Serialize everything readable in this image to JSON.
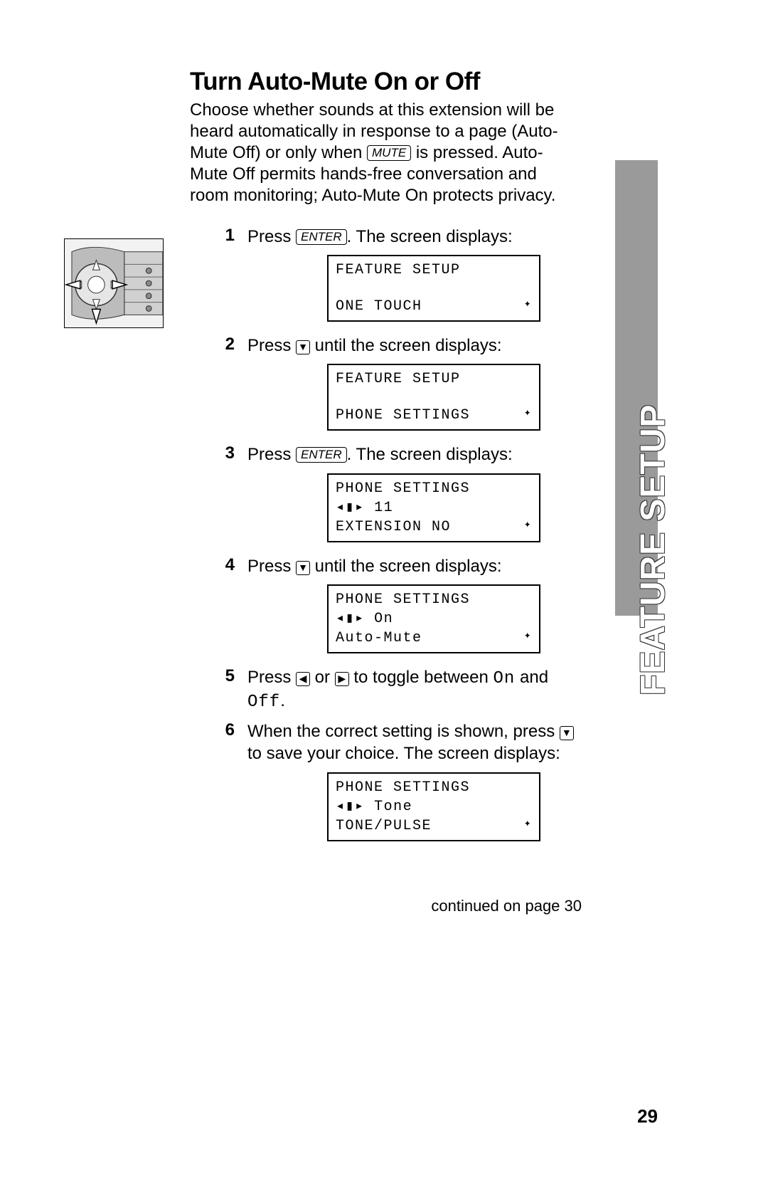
{
  "title": "Turn Auto-Mute On or Off",
  "intro": {
    "p1a": "Choose whether sounds at this extension will be heard automatically in response to a page (Auto-Mute Off) or only when ",
    "mute_key": "MUTE",
    "p1b": " is pressed.  Auto-Mute Off permits hands-free conversation and room monitoring; Auto-Mute On protects privacy."
  },
  "side_tab": "FEATURE SETUP",
  "keys": {
    "enter": "ENTER",
    "down": "▼",
    "left": "◀",
    "right": "▶"
  },
  "steps": [
    {
      "n": "1",
      "pre": "Press ",
      "key": "enter",
      "post": ".  The screen displays:",
      "lcd": {
        "l1": "FEATURE SETUP",
        "l2": "",
        "l3": "ONE TOUCH",
        "nav": "⯁"
      }
    },
    {
      "n": "2",
      "pre": "Press ",
      "key": "down",
      "post": " until the screen displays:",
      "lcd": {
        "l1": "FEATURE SETUP",
        "l2": "",
        "l3": "PHONE SETTINGS",
        "nav": "⯁"
      }
    },
    {
      "n": "3",
      "pre": "Press ",
      "key": "enter",
      "post": ".  The screen displays:",
      "lcd": {
        "l1": "PHONE SETTINGS",
        "l2": "�興 11",
        "l3": "EXTENSION NO",
        "nav": "⯁"
      }
    },
    {
      "n": "4",
      "pre": "Press ",
      "key": "down",
      "post": " until the screen displays:",
      "lcd": {
        "l1": "PHONE SETTINGS",
        "l2": "⯁ On",
        "l3": "Auto-Mute",
        "nav": "⯁"
      }
    },
    {
      "n": "5",
      "text_a": "Press ",
      "text_b": " or ",
      "text_c": " to toggle between ",
      "val1": "On",
      "text_d": " and ",
      "val2": "Off",
      "text_e": "."
    },
    {
      "n": "6",
      "text_a": "When the correct setting is shown, press ",
      "text_b": " to save your choice.  The screen displays:",
      "lcd": {
        "l1": "PHONE SETTINGS",
        "l2": "⯁ Tone",
        "l3": "TONE/PULSE",
        "nav": "⯁"
      }
    }
  ],
  "lcd_mid_prefix": "◂▮▸ ",
  "continued": "continued on page 30",
  "page_number": "29"
}
